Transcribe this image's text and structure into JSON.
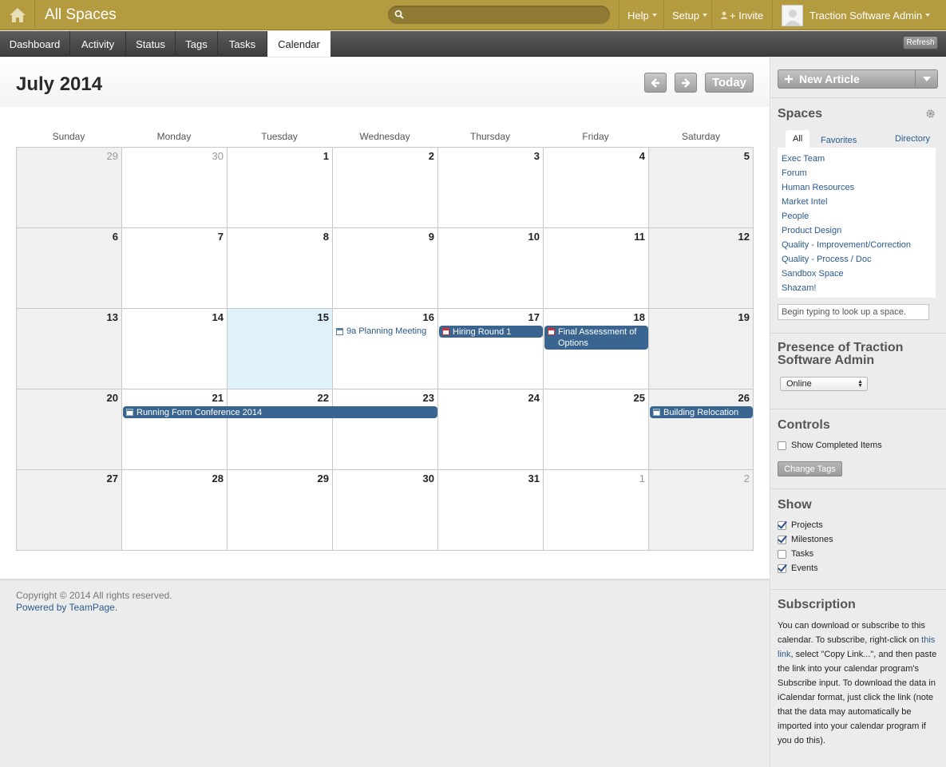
{
  "topbar": {
    "title": "All Spaces",
    "search_placeholder": "",
    "help": "Help",
    "setup": "Setup",
    "invite": "+ Invite",
    "user": "Traction Software Admin"
  },
  "tabs": [
    "Dashboard",
    "Activity",
    "Status",
    "Tags",
    "Tasks",
    "Calendar"
  ],
  "refresh": "Refresh",
  "calendar": {
    "month_title": "July 2014",
    "today_label": "Today",
    "weekdays": [
      "Sunday",
      "Monday",
      "Tuesday",
      "Wednesday",
      "Thursday",
      "Friday",
      "Saturday"
    ],
    "weeks": [
      [
        "29",
        "30",
        "1",
        "2",
        "3",
        "4",
        "5"
      ],
      [
        "6",
        "7",
        "8",
        "9",
        "10",
        "11",
        "12"
      ],
      [
        "13",
        "14",
        "15",
        "16",
        "17",
        "18",
        "19"
      ],
      [
        "20",
        "21",
        "22",
        "23",
        "24",
        "25",
        "26"
      ],
      [
        "27",
        "28",
        "29",
        "30",
        "31",
        "1",
        "2"
      ]
    ],
    "events": {
      "planning_meeting": "9a Planning Meeting",
      "hiring_round": "Hiring Round 1",
      "final_assessment": "Final Assessment of Options",
      "running_form": "Running Form Conference 2014",
      "building_relocation": "Building Relocation"
    }
  },
  "footer": {
    "copyright": "Copyright © 2014 All rights reserved.",
    "powered_by": "Powered by TeamPage."
  },
  "sidebar": {
    "new_article": "New Article",
    "spaces_heading": "Spaces",
    "spaces_tabs": {
      "all": "All",
      "favorites": "Favorites",
      "directory": "Directory"
    },
    "spaces": [
      "Exec Team",
      "Forum",
      "Human Resources",
      "Market Intel",
      "People",
      "Product Design",
      "Quality - Improvement/Correction",
      "Quality - Process / Doc",
      "Sandbox Space",
      "Shazam!"
    ],
    "lookup_placeholder": "Begin typing to look up a space.",
    "presence_heading": "Presence of Traction Software Admin",
    "presence_value": "Online",
    "controls_heading": "Controls",
    "show_completed": "Show Completed Items",
    "change_tags": "Change Tags",
    "show_heading": "Show",
    "show_items": [
      {
        "label": "Projects",
        "checked": true
      },
      {
        "label": "Milestones",
        "checked": true
      },
      {
        "label": "Tasks",
        "checked": false
      },
      {
        "label": "Events",
        "checked": true
      }
    ],
    "subscription_heading": "Subscription",
    "subscription_before": "You can download or subscribe to this calendar. To subscribe, right-click on ",
    "subscription_link": "this link",
    "subscription_after": ", select \"Copy Link...\", and then paste the link into your calendar program's Subscribe input. To download the data in iCalendar format, just click the link (note that the data may automatically be imported into your calendar program if you do this)."
  }
}
